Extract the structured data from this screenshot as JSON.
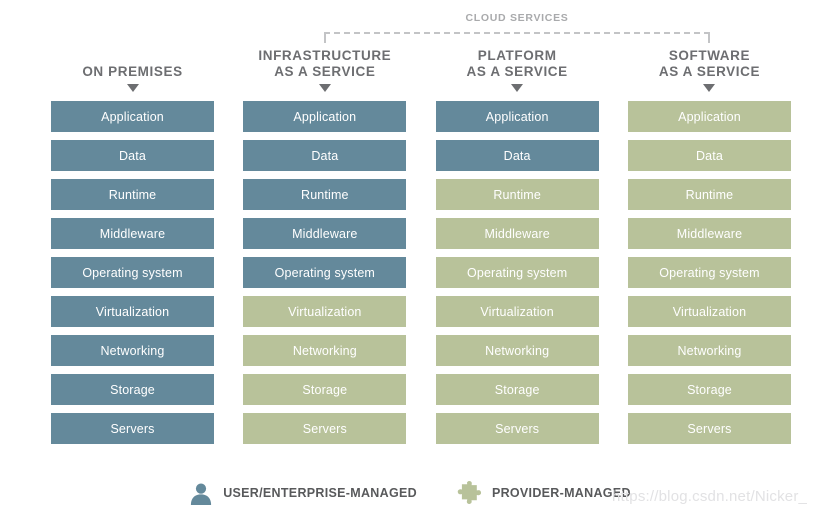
{
  "cloud_bracket": {
    "label": "CLOUD SERVICES"
  },
  "legend": {
    "user": {
      "icon": "person-icon",
      "label": "USER/ENTERPRISE-MANAGED",
      "color": "#64899b"
    },
    "provider": {
      "icon": "puzzle-piece-icon",
      "label": "PROVIDER-MANAGED",
      "color": "#b8c29a"
    }
  },
  "watermark": {
    "text": "https://blog.csdn.net/Nicker_"
  },
  "colors": {
    "user_managed": "#64899b",
    "provider_managed": "#b8c29a",
    "heading_text": "#6d6e71",
    "bracket": "#c3c4c6"
  },
  "layer_names": [
    "Application",
    "Data",
    "Runtime",
    "Middleware",
    "Operating system",
    "Virtualization",
    "Networking",
    "Storage",
    "Servers"
  ],
  "columns": [
    {
      "id": "on-premises",
      "title_lines": [
        "ON PREMISES"
      ],
      "arrow": "triangle-down-icon",
      "layers": [
        {
          "label": "Application",
          "owner": "user"
        },
        {
          "label": "Data",
          "owner": "user"
        },
        {
          "label": "Runtime",
          "owner": "user"
        },
        {
          "label": "Middleware",
          "owner": "user"
        },
        {
          "label": "Operating system",
          "owner": "user"
        },
        {
          "label": "Virtualization",
          "owner": "user"
        },
        {
          "label": "Networking",
          "owner": "user"
        },
        {
          "label": "Storage",
          "owner": "user"
        },
        {
          "label": "Servers",
          "owner": "user"
        }
      ]
    },
    {
      "id": "infrastructure-as-a-service",
      "title_lines": [
        "INFRASTRUCTURE",
        "AS A SERVICE"
      ],
      "arrow": "triangle-down-icon",
      "layers": [
        {
          "label": "Application",
          "owner": "user"
        },
        {
          "label": "Data",
          "owner": "user"
        },
        {
          "label": "Runtime",
          "owner": "user"
        },
        {
          "label": "Middleware",
          "owner": "user"
        },
        {
          "label": "Operating system",
          "owner": "user"
        },
        {
          "label": "Virtualization",
          "owner": "provider"
        },
        {
          "label": "Networking",
          "owner": "provider"
        },
        {
          "label": "Storage",
          "owner": "provider"
        },
        {
          "label": "Servers",
          "owner": "provider"
        }
      ]
    },
    {
      "id": "platform-as-a-service",
      "title_lines": [
        "PLATFORM",
        "AS A SERVICE"
      ],
      "arrow": "triangle-down-icon",
      "layers": [
        {
          "label": "Application",
          "owner": "user"
        },
        {
          "label": "Data",
          "owner": "user"
        },
        {
          "label": "Runtime",
          "owner": "provider"
        },
        {
          "label": "Middleware",
          "owner": "provider"
        },
        {
          "label": "Operating system",
          "owner": "provider"
        },
        {
          "label": "Virtualization",
          "owner": "provider"
        },
        {
          "label": "Networking",
          "owner": "provider"
        },
        {
          "label": "Storage",
          "owner": "provider"
        },
        {
          "label": "Servers",
          "owner": "provider"
        }
      ]
    },
    {
      "id": "software-as-a-service",
      "title_lines": [
        "SOFTWARE",
        "AS A SERVICE"
      ],
      "arrow": "triangle-down-icon",
      "layers": [
        {
          "label": "Application",
          "owner": "provider"
        },
        {
          "label": "Data",
          "owner": "provider"
        },
        {
          "label": "Runtime",
          "owner": "provider"
        },
        {
          "label": "Middleware",
          "owner": "provider"
        },
        {
          "label": "Operating system",
          "owner": "provider"
        },
        {
          "label": "Virtualization",
          "owner": "provider"
        },
        {
          "label": "Networking",
          "owner": "provider"
        },
        {
          "label": "Storage",
          "owner": "provider"
        },
        {
          "label": "Servers",
          "owner": "provider"
        }
      ]
    }
  ]
}
